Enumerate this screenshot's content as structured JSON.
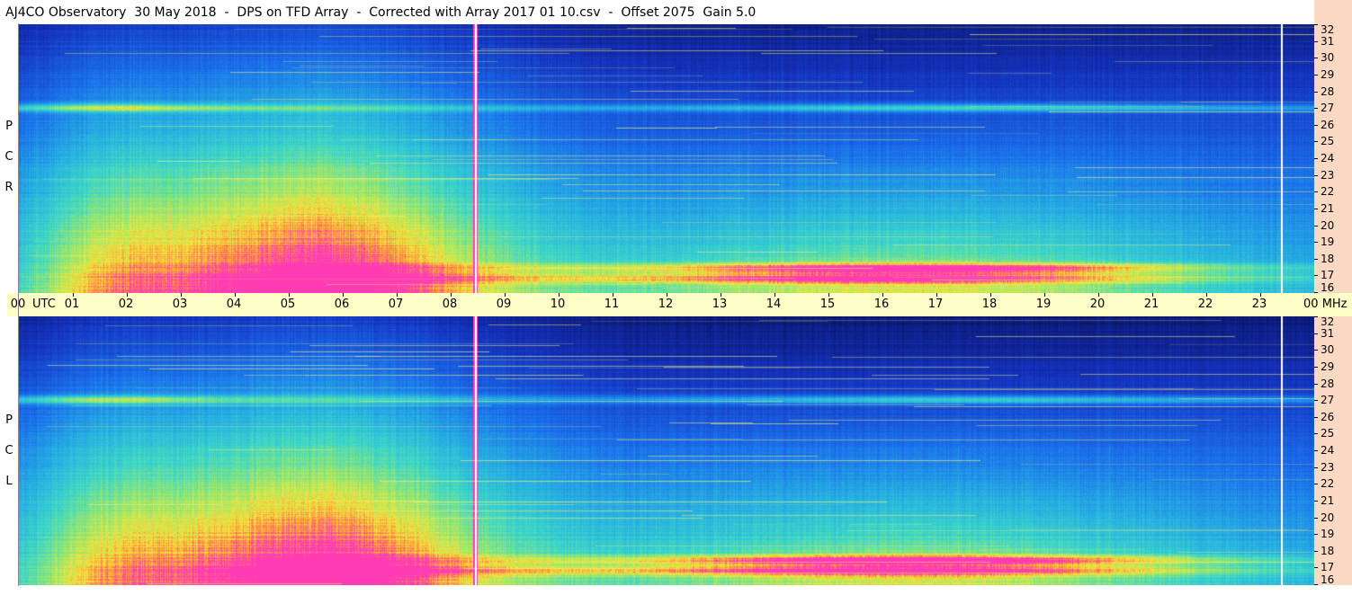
{
  "title": "AJ4CO Observatory  30 May 2018  -  DPS on TFD Array  -  Corrected with Array 2017 01 10.csv  -  Offset 2075  Gain 5.0",
  "panels": {
    "rcp": {
      "letters": [
        "R",
        "C",
        "P"
      ]
    },
    "lcp": {
      "letters": [
        "L",
        "C",
        "P"
      ]
    }
  },
  "freq_axis": {
    "labels": [
      "32",
      "31",
      "30",
      "29",
      "28",
      "27",
      "26",
      "25",
      "24",
      "23",
      "22",
      "21",
      "20",
      "19",
      "18",
      "17",
      "16"
    ],
    "values": [
      32,
      31,
      30,
      29,
      28,
      27,
      26,
      25,
      24,
      23,
      22,
      21,
      20,
      19,
      18,
      17,
      16
    ]
  },
  "time_axis": {
    "start_label": "00",
    "utc_label": "UTC",
    "hour_labels": [
      "01",
      "02",
      "03",
      "04",
      "05",
      "06",
      "07",
      "08",
      "09",
      "10",
      "11",
      "12",
      "13",
      "14",
      "15",
      "16",
      "17",
      "18",
      "19",
      "20",
      "21",
      "22",
      "23"
    ],
    "end_label": "00",
    "unit_label": "MHz"
  },
  "colors": {
    "low": "#0a1a6e",
    "mid": "#1a6fe6",
    "high": "#3fd6c8",
    "hot": "#f0e040",
    "peak": "#ff3fb0",
    "axis_bg": "#fcd9c3",
    "time_bg": "#ffffc8"
  }
}
